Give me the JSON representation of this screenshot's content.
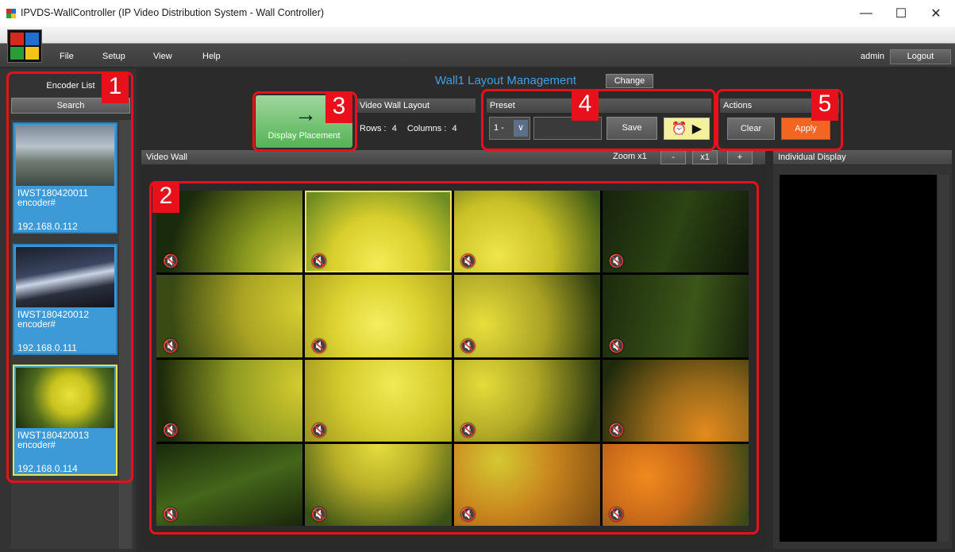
{
  "window": {
    "title": "IPVDS-WallController (IP Video Distribution System - Wall Controller)",
    "min_glyph": "—",
    "max_glyph": "☐",
    "close_glyph": "✕"
  },
  "menu": {
    "items": [
      "File",
      "Setup",
      "View",
      "Help"
    ],
    "user": "admin",
    "logout": "Logout"
  },
  "encoder_list": {
    "title": "Encoder List",
    "search": "Search",
    "encoders": [
      {
        "name": "IWST180420011",
        "type": "encoder#",
        "ip": "192.168.0.112"
      },
      {
        "name": "IWST180420012",
        "type": "encoder#",
        "ip": "192.168.0.111"
      },
      {
        "name": "IWST180420013",
        "type": "encoder#",
        "ip": "192.168.0.114"
      }
    ],
    "selected_index": 2
  },
  "wall": {
    "title": "Wall1 Layout Management",
    "change": "Change"
  },
  "display_placement": {
    "label": "Display Placement",
    "arrow": "→"
  },
  "video_wall_layout": {
    "title": "Video Wall Layout",
    "rows_label": "Rows :",
    "rows": "4",
    "columns_label": "Columns :",
    "columns": "4"
  },
  "preset": {
    "title": "Preset",
    "selected": "1 -",
    "name_value": "",
    "save": "Save",
    "clock_glyph": "⏰",
    "play_glyph": "▶"
  },
  "actions": {
    "title": "Actions",
    "clear": "Clear",
    "apply": "Apply"
  },
  "video_wall": {
    "title": "Video Wall",
    "zoom_label": "Zoom x1",
    "zoom_out": "-",
    "zoom_reset": "x1",
    "zoom_in": "+",
    "mute_glyph": "🔇",
    "selected_cell": 1
  },
  "individual_display": {
    "title": "Individual Display"
  },
  "callouts": [
    "1",
    "2",
    "3",
    "4",
    "5"
  ],
  "colors": {
    "accent_blue": "#3fa0e8",
    "encoder_card": "#3d9ad6",
    "apply_orange": "#f26522",
    "callout_red": "#e8101a",
    "select_yellow": "#e8e34a"
  }
}
